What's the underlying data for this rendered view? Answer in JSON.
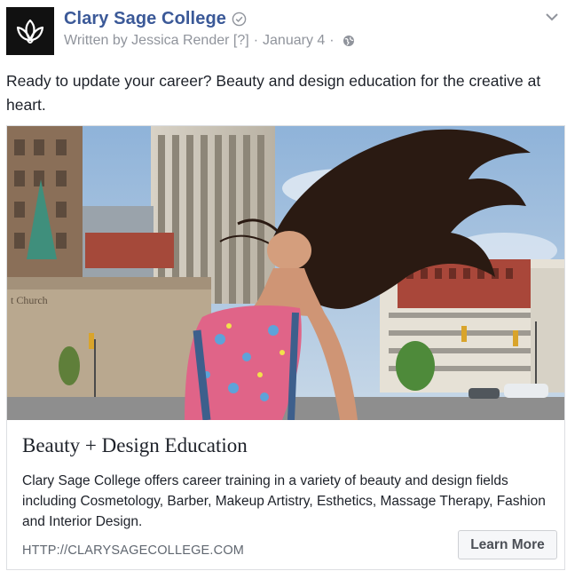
{
  "header": {
    "page_name": "Clary Sage College",
    "author_line": "Written by Jessica Render [?]",
    "separator": "·",
    "date": "January 4",
    "icons": [
      "logo-lotus-icon",
      "verified-check-icon",
      "globe-icon",
      "chevron-down-icon"
    ]
  },
  "post": {
    "text": "Ready to update your career? Beauty and design education for the creative at heart."
  },
  "card": {
    "image_alt": "Woman with long dark hair flipping her head back in a city street",
    "title": "Beauty + Design Education",
    "description": "Clary Sage College offers career training in a variety of beauty and design fields including Cosmetology, Barber, Makeup Artistry, Esthetics, Massage Therapy, Fashion and Interior Design.",
    "url": "HTTP://CLARYSAGECOLLEGE.COM",
    "cta_label": "Learn More",
    "sign_text": "t Church"
  },
  "colors": {
    "brand_link": "#3b5998",
    "meta_text": "#90949c",
    "body_text": "#1d2129",
    "card_border": "#dddfe2"
  }
}
